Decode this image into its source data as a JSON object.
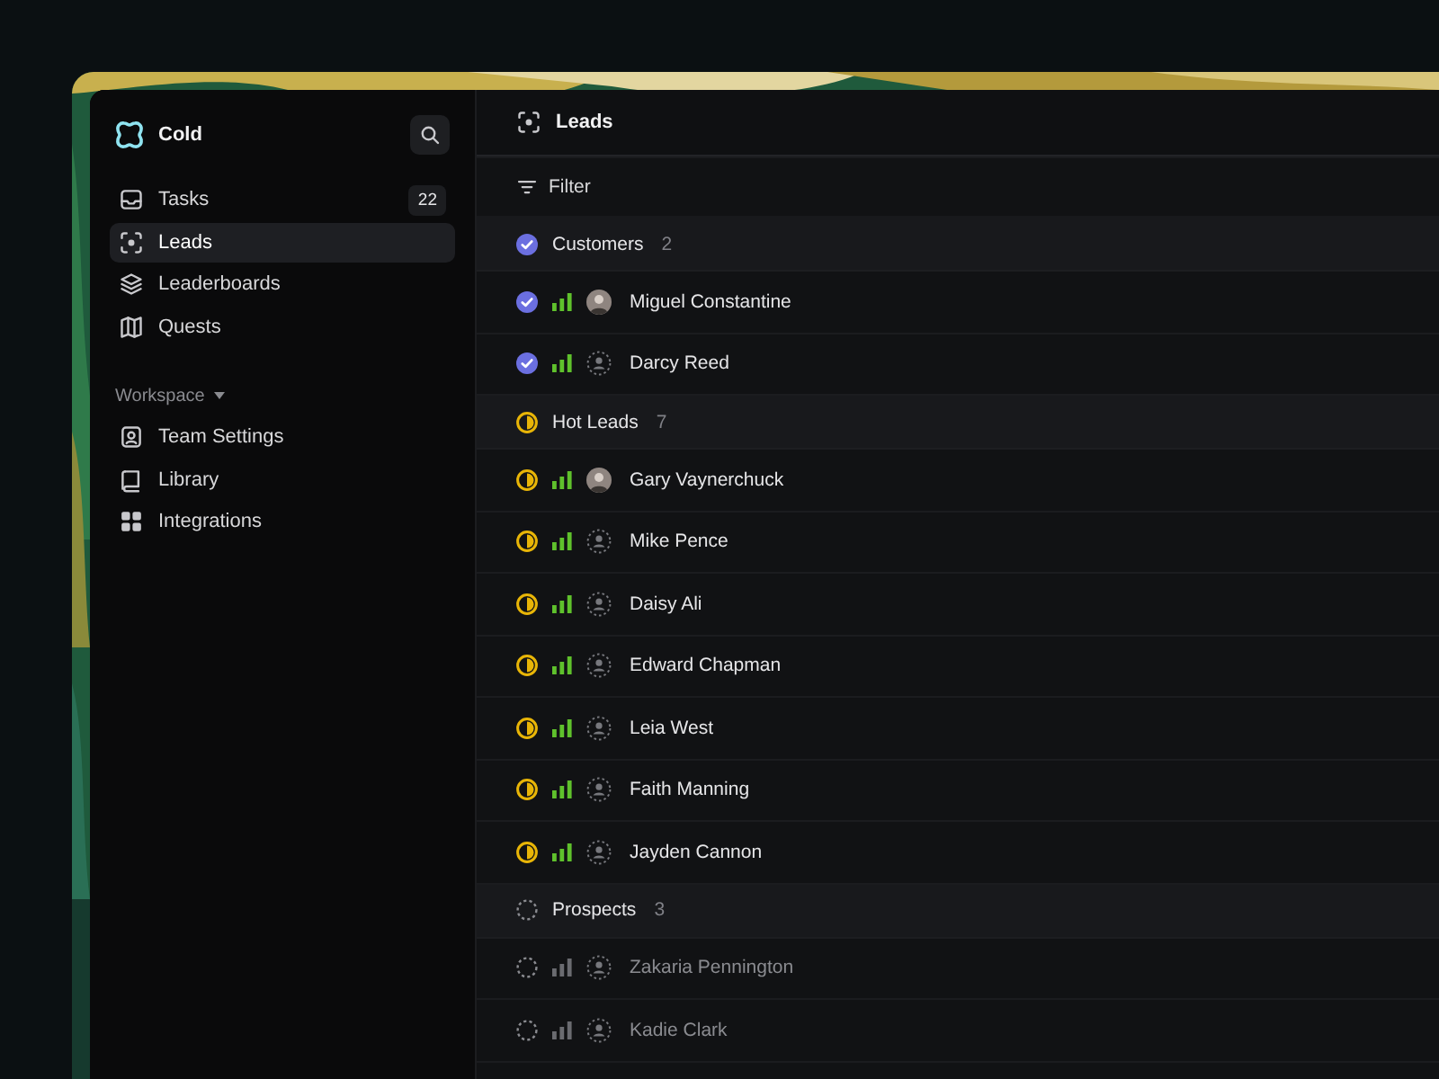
{
  "app": {
    "name": "Cold"
  },
  "sidebar": {
    "items": [
      {
        "label": "Tasks",
        "count": "22",
        "selected": false
      },
      {
        "label": "Leads",
        "selected": true
      },
      {
        "label": "Leaderboards",
        "selected": false
      },
      {
        "label": "Quests",
        "selected": false
      }
    ],
    "section": {
      "label": "Workspace",
      "expanded": true
    },
    "workspace_items": [
      {
        "label": "Team Settings",
        "selected": false
      },
      {
        "label": "Library",
        "selected": false
      },
      {
        "label": "Integrations",
        "selected": false
      }
    ]
  },
  "header": {
    "title": "Leads"
  },
  "toolbar": {
    "filter": "Filter"
  },
  "groups": [
    {
      "name": "Customers",
      "count": "2",
      "kind": "customer",
      "rows": [
        {
          "name": "Miguel Constantine",
          "photo": true
        },
        {
          "name": "Darcy Reed",
          "photo": false
        }
      ]
    },
    {
      "name": "Hot Leads",
      "count": "7",
      "kind": "hot",
      "rows": [
        {
          "name": "Gary Vaynerchuck",
          "photo": true
        },
        {
          "name": "Mike Pence",
          "photo": false
        },
        {
          "name": "Daisy Ali",
          "photo": false
        },
        {
          "name": "Edward Chapman",
          "photo": false
        },
        {
          "name": "Leia West",
          "photo": false
        },
        {
          "name": "Faith Manning",
          "photo": false
        },
        {
          "name": "Jayden Cannon",
          "photo": false
        }
      ]
    },
    {
      "name": "Prospects",
      "count": "3",
      "kind": "prospect",
      "rows": [
        {
          "name": "Zakaria Pennington",
          "photo": false
        },
        {
          "name": "Kadie Clark",
          "photo": false
        }
      ]
    }
  ]
}
